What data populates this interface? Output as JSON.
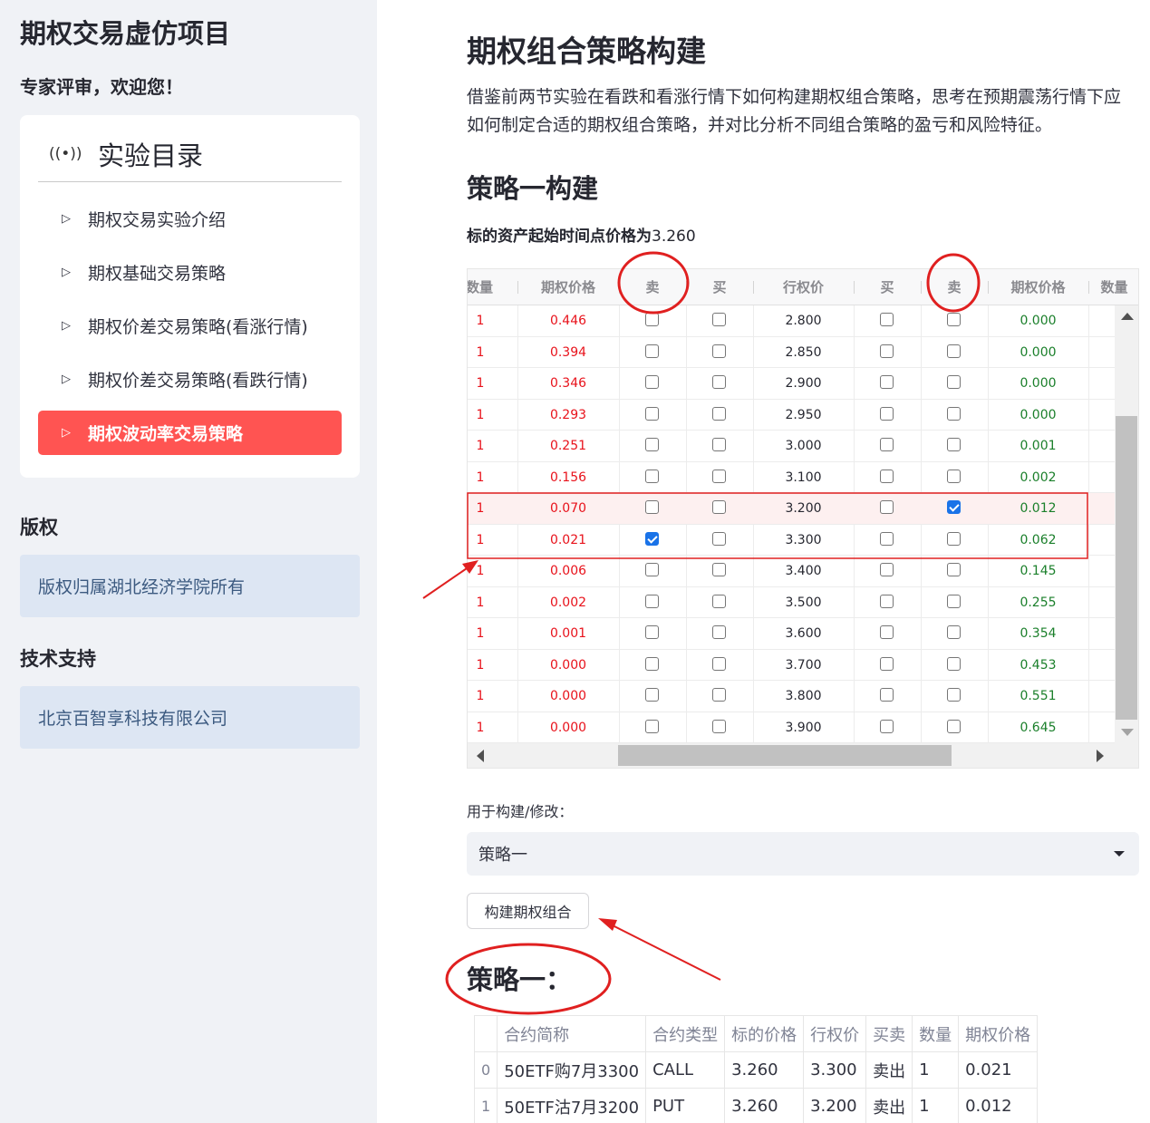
{
  "sidebar": {
    "app_title": "期权交易虚仿项目",
    "welcome": "专家评审，欢迎您！",
    "menu_title": "实验目录",
    "menu_items": [
      {
        "label": "期权交易实验介绍"
      },
      {
        "label": "期权基础交易策略"
      },
      {
        "label": "期权价差交易策略(看涨行情)"
      },
      {
        "label": "期权价差交易策略(看跌行情)"
      },
      {
        "label": "期权波动率交易策略"
      }
    ],
    "active_index": 4,
    "copyright_head": "版权",
    "copyright_text": "版权归属湖北经济学院所有",
    "support_head": "技术支持",
    "support_text": "北京百智享科技有限公司"
  },
  "main": {
    "title": "期权组合策略构建",
    "intro": "借鉴前两节实验在看跌和看涨行情下如何构建期权组合策略，思考在预期震荡行情下应如何制定合适的期权组合策略，并对比分析不同组合策略的盈亏和风险特征。",
    "section_title": "策略一构建",
    "price_label": "标的资产起始时间点价格为",
    "price_value": "3.260",
    "grid": {
      "headers": [
        "数量",
        "期权价格",
        "卖",
        "买",
        "行权价",
        "买",
        "卖",
        "期权价格",
        "数量"
      ],
      "rows": [
        {
          "qty": "1",
          "call_price": "0.446",
          "call_sell": false,
          "call_buy": false,
          "strike": "2.800",
          "put_buy": false,
          "put_sell": false,
          "put_price": "0.000"
        },
        {
          "qty": "1",
          "call_price": "0.394",
          "call_sell": false,
          "call_buy": false,
          "strike": "2.850",
          "put_buy": false,
          "put_sell": false,
          "put_price": "0.000"
        },
        {
          "qty": "1",
          "call_price": "0.346",
          "call_sell": false,
          "call_buy": false,
          "strike": "2.900",
          "put_buy": false,
          "put_sell": false,
          "put_price": "0.000"
        },
        {
          "qty": "1",
          "call_price": "0.293",
          "call_sell": false,
          "call_buy": false,
          "strike": "2.950",
          "put_buy": false,
          "put_sell": false,
          "put_price": "0.000"
        },
        {
          "qty": "1",
          "call_price": "0.251",
          "call_sell": false,
          "call_buy": false,
          "strike": "3.000",
          "put_buy": false,
          "put_sell": false,
          "put_price": "0.001"
        },
        {
          "qty": "1",
          "call_price": "0.156",
          "call_sell": false,
          "call_buy": false,
          "strike": "3.100",
          "put_buy": false,
          "put_sell": false,
          "put_price": "0.002"
        },
        {
          "qty": "1",
          "call_price": "0.070",
          "call_sell": false,
          "call_buy": false,
          "strike": "3.200",
          "put_buy": false,
          "put_sell": true,
          "put_price": "0.012"
        },
        {
          "qty": "1",
          "call_price": "0.021",
          "call_sell": true,
          "call_buy": false,
          "strike": "3.300",
          "put_buy": false,
          "put_sell": false,
          "put_price": "0.062"
        },
        {
          "qty": "1",
          "call_price": "0.006",
          "call_sell": false,
          "call_buy": false,
          "strike": "3.400",
          "put_buy": false,
          "put_sell": false,
          "put_price": "0.145"
        },
        {
          "qty": "1",
          "call_price": "0.002",
          "call_sell": false,
          "call_buy": false,
          "strike": "3.500",
          "put_buy": false,
          "put_sell": false,
          "put_price": "0.255"
        },
        {
          "qty": "1",
          "call_price": "0.001",
          "call_sell": false,
          "call_buy": false,
          "strike": "3.600",
          "put_buy": false,
          "put_sell": false,
          "put_price": "0.354"
        },
        {
          "qty": "1",
          "call_price": "0.000",
          "call_sell": false,
          "call_buy": false,
          "strike": "3.700",
          "put_buy": false,
          "put_sell": false,
          "put_price": "0.453"
        },
        {
          "qty": "1",
          "call_price": "0.000",
          "call_sell": false,
          "call_buy": false,
          "strike": "3.800",
          "put_buy": false,
          "put_sell": false,
          "put_price": "0.551"
        },
        {
          "qty": "1",
          "call_price": "0.000",
          "call_sell": false,
          "call_buy": false,
          "strike": "3.900",
          "put_buy": false,
          "put_sell": false,
          "put_price": "0.645"
        }
      ]
    },
    "select_label": "用于构建/修改：",
    "select_value": "策略一",
    "build_button": "构建期权组合",
    "result_title": "策略一：",
    "result_table": {
      "headers": [
        "",
        "合约简称",
        "合约类型",
        "标的价格",
        "行权价",
        "买卖",
        "数量",
        "期权价格"
      ],
      "rows": [
        [
          "0",
          "50ETF购7月3300",
          "CALL",
          "3.260",
          "3.300",
          "卖出",
          "1",
          "0.021"
        ],
        [
          "1",
          "50ETF沽7月3200",
          "PUT",
          "3.260",
          "3.200",
          "卖出",
          "1",
          "0.012"
        ]
      ]
    }
  },
  "colors": {
    "accent": "#ff5452",
    "sidebar_bg": "#f0f2f6",
    "info_box": "#dde6f3",
    "call_price": "#e8121b",
    "put_price": "#1a7f2a",
    "annotation": "#e02020"
  }
}
